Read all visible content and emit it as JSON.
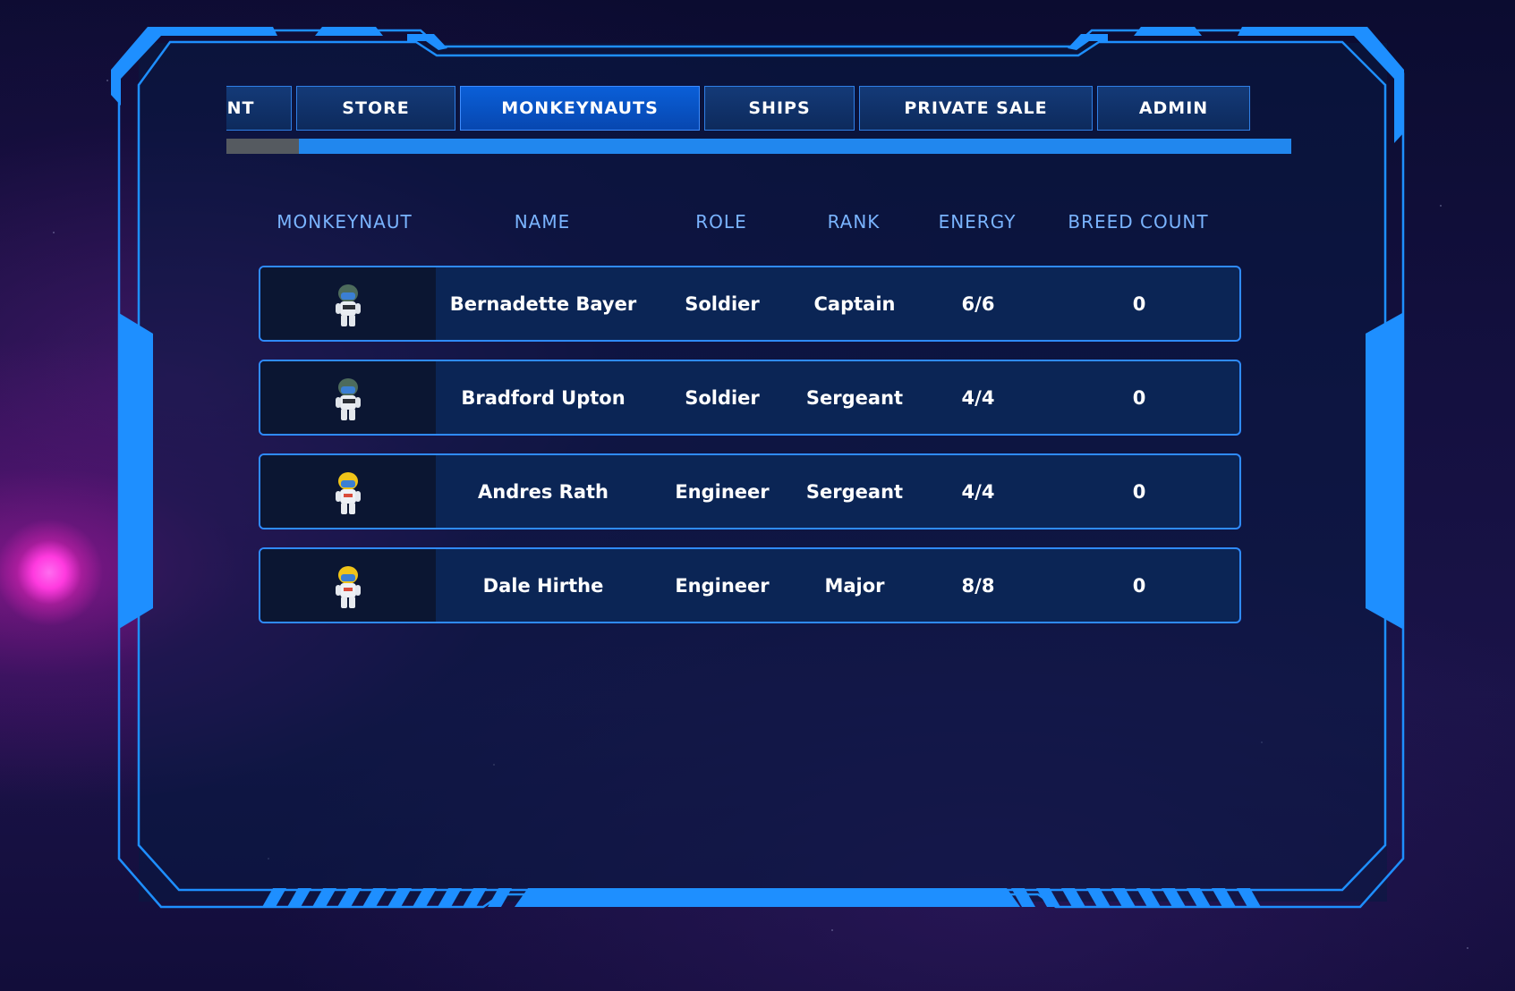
{
  "tabs": [
    {
      "label": "ACCOUNT",
      "active": false
    },
    {
      "label": "STORE",
      "active": false
    },
    {
      "label": "MONKEYNAUTS",
      "active": true
    },
    {
      "label": "SHIPS",
      "active": false
    },
    {
      "label": "PRIVATE SALE",
      "active": false
    },
    {
      "label": "ADMIN",
      "active": false
    }
  ],
  "table": {
    "headers": {
      "monkeynaut": "MONKEYNAUT",
      "name": "NAME",
      "role": "ROLE",
      "rank": "RANK",
      "energy": "ENERGY",
      "breed_count": "BREED COUNT"
    },
    "rows": [
      {
        "name": "Bernadette Bayer",
        "role": "Soldier",
        "rank": "Captain",
        "energy": "6/6",
        "breed_count": "0",
        "avatar": "soldier-monkeynaut-icon"
      },
      {
        "name": "Bradford Upton",
        "role": "Soldier",
        "rank": "Sergeant",
        "energy": "4/4",
        "breed_count": "0",
        "avatar": "soldier-monkeynaut-icon"
      },
      {
        "name": "Andres Rath",
        "role": "Engineer",
        "rank": "Sergeant",
        "energy": "4/4",
        "breed_count": "0",
        "avatar": "engineer-monkeynaut-icon"
      },
      {
        "name": "Dale Hirthe",
        "role": "Engineer",
        "rank": "Major",
        "energy": "8/8",
        "breed_count": "0",
        "avatar": "engineer-monkeynaut-icon"
      }
    ]
  },
  "colors": {
    "frame": "#1e8fff",
    "active_tab": "#0a5fd8",
    "header_text": "#7ab4ff",
    "row_border": "#2f8bff"
  }
}
